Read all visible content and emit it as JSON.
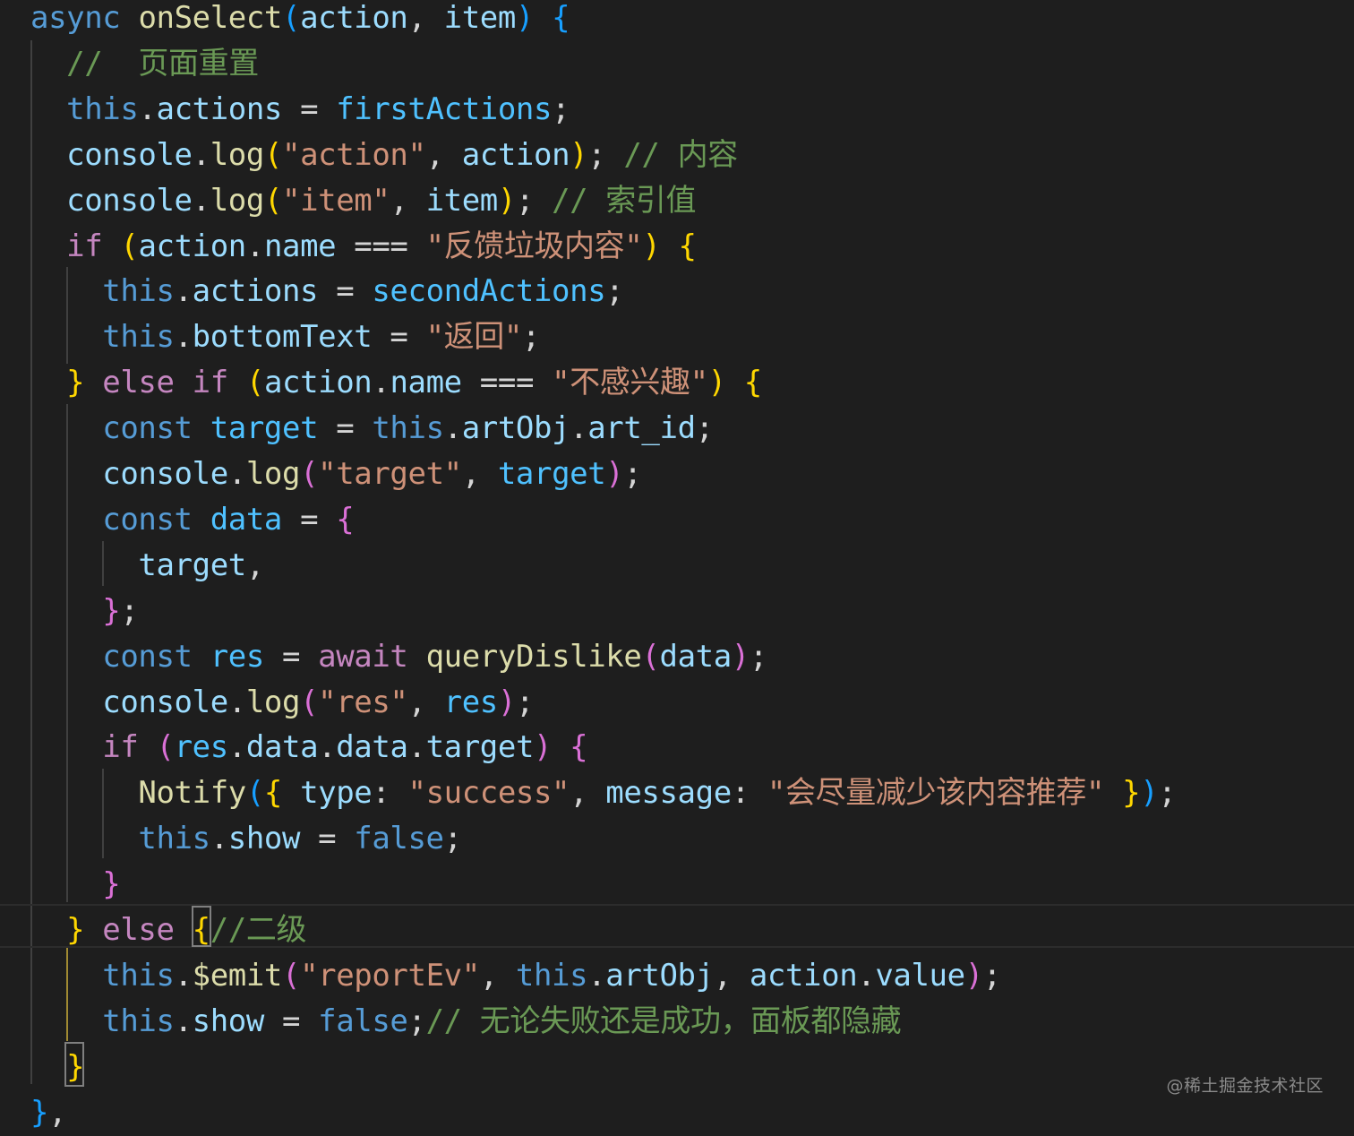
{
  "editor": {
    "language": "javascript",
    "theme_colors": {
      "background": "#1e1e1e",
      "keyword": "#569cd6",
      "control": "#c586c0",
      "function": "#dcdcaa",
      "variable": "#9cdcfe",
      "constant": "#4fc1ff",
      "string": "#ce9178",
      "comment": "#6a9955",
      "bracket_level1": "#ffd700",
      "bracket_level2": "#da70d6",
      "bracket_level3": "#179fff"
    },
    "lines": [
      [
        [
          "kw",
          "async"
        ],
        [
          "pu",
          " "
        ],
        [
          "fn",
          "onSelect"
        ],
        [
          "b3",
          "("
        ],
        [
          "var",
          "action"
        ],
        [
          "pu",
          ", "
        ],
        [
          "var",
          "item"
        ],
        [
          "b3",
          ")"
        ],
        [
          "pu",
          " "
        ],
        [
          "b3",
          "{"
        ]
      ],
      [
        [
          "pu",
          "  "
        ],
        [
          "cm",
          "//  页面重置"
        ]
      ],
      [
        [
          "pu",
          "  "
        ],
        [
          "kw",
          "this"
        ],
        [
          "pu",
          "."
        ],
        [
          "var",
          "actions"
        ],
        [
          "pu",
          " = "
        ],
        [
          "cst",
          "firstActions"
        ],
        [
          "pu",
          ";"
        ]
      ],
      [
        [
          "pu",
          "  "
        ],
        [
          "var",
          "console"
        ],
        [
          "pu",
          "."
        ],
        [
          "fn",
          "log"
        ],
        [
          "b1",
          "("
        ],
        [
          "str",
          "\"action\""
        ],
        [
          "pu",
          ", "
        ],
        [
          "var",
          "action"
        ],
        [
          "b1",
          ")"
        ],
        [
          "pu",
          "; "
        ],
        [
          "cm",
          "// 内容"
        ]
      ],
      [
        [
          "pu",
          "  "
        ],
        [
          "var",
          "console"
        ],
        [
          "pu",
          "."
        ],
        [
          "fn",
          "log"
        ],
        [
          "b1",
          "("
        ],
        [
          "str",
          "\"item\""
        ],
        [
          "pu",
          ", "
        ],
        [
          "var",
          "item"
        ],
        [
          "b1",
          ")"
        ],
        [
          "pu",
          "; "
        ],
        [
          "cm",
          "// 索引值"
        ]
      ],
      [
        [
          "pu",
          "  "
        ],
        [
          "ctl",
          "if"
        ],
        [
          "pu",
          " "
        ],
        [
          "b1",
          "("
        ],
        [
          "var",
          "action"
        ],
        [
          "pu",
          "."
        ],
        [
          "var",
          "name"
        ],
        [
          "pu",
          " === "
        ],
        [
          "str",
          "\"反馈垃圾内容\""
        ],
        [
          "b1",
          ")"
        ],
        [
          "pu",
          " "
        ],
        [
          "b1",
          "{"
        ]
      ],
      [
        [
          "pu",
          "    "
        ],
        [
          "kw",
          "this"
        ],
        [
          "pu",
          "."
        ],
        [
          "var",
          "actions"
        ],
        [
          "pu",
          " = "
        ],
        [
          "cst",
          "secondActions"
        ],
        [
          "pu",
          ";"
        ]
      ],
      [
        [
          "pu",
          "    "
        ],
        [
          "kw",
          "this"
        ],
        [
          "pu",
          "."
        ],
        [
          "var",
          "bottomText"
        ],
        [
          "pu",
          " = "
        ],
        [
          "str",
          "\"返回\""
        ],
        [
          "pu",
          ";"
        ]
      ],
      [
        [
          "pu",
          "  "
        ],
        [
          "b1",
          "}"
        ],
        [
          "pu",
          " "
        ],
        [
          "ctl",
          "else if"
        ],
        [
          "pu",
          " "
        ],
        [
          "b1",
          "("
        ],
        [
          "var",
          "action"
        ],
        [
          "pu",
          "."
        ],
        [
          "var",
          "name"
        ],
        [
          "pu",
          " === "
        ],
        [
          "str",
          "\"不感兴趣\""
        ],
        [
          "b1",
          ")"
        ],
        [
          "pu",
          " "
        ],
        [
          "b1",
          "{"
        ]
      ],
      [
        [
          "pu",
          "    "
        ],
        [
          "kw",
          "const"
        ],
        [
          "pu",
          " "
        ],
        [
          "cst",
          "target"
        ],
        [
          "pu",
          " = "
        ],
        [
          "kw",
          "this"
        ],
        [
          "pu",
          "."
        ],
        [
          "var",
          "artObj"
        ],
        [
          "pu",
          "."
        ],
        [
          "var",
          "art_id"
        ],
        [
          "pu",
          ";"
        ]
      ],
      [
        [
          "pu",
          "    "
        ],
        [
          "var",
          "console"
        ],
        [
          "pu",
          "."
        ],
        [
          "fn",
          "log"
        ],
        [
          "b2",
          "("
        ],
        [
          "str",
          "\"target\""
        ],
        [
          "pu",
          ", "
        ],
        [
          "cst",
          "target"
        ],
        [
          "b2",
          ")"
        ],
        [
          "pu",
          ";"
        ]
      ],
      [
        [
          "pu",
          "    "
        ],
        [
          "kw",
          "const"
        ],
        [
          "pu",
          " "
        ],
        [
          "cst",
          "data"
        ],
        [
          "pu",
          " = "
        ],
        [
          "b2",
          "{"
        ]
      ],
      [
        [
          "pu",
          "      "
        ],
        [
          "var",
          "target"
        ],
        [
          "pu",
          ","
        ]
      ],
      [
        [
          "pu",
          "    "
        ],
        [
          "b2",
          "}"
        ],
        [
          "pu",
          ";"
        ]
      ],
      [
        [
          "pu",
          "    "
        ],
        [
          "kw",
          "const"
        ],
        [
          "pu",
          " "
        ],
        [
          "cst",
          "res"
        ],
        [
          "pu",
          " = "
        ],
        [
          "ctl",
          "await"
        ],
        [
          "pu",
          " "
        ],
        [
          "fn",
          "queryDislike"
        ],
        [
          "b2",
          "("
        ],
        [
          "var",
          "data"
        ],
        [
          "b2",
          ")"
        ],
        [
          "pu",
          ";"
        ]
      ],
      [
        [
          "pu",
          "    "
        ],
        [
          "var",
          "console"
        ],
        [
          "pu",
          "."
        ],
        [
          "fn",
          "log"
        ],
        [
          "b2",
          "("
        ],
        [
          "str",
          "\"res\""
        ],
        [
          "pu",
          ", "
        ],
        [
          "cst",
          "res"
        ],
        [
          "b2",
          ")"
        ],
        [
          "pu",
          ";"
        ]
      ],
      [
        [
          "pu",
          "    "
        ],
        [
          "ctl",
          "if"
        ],
        [
          "pu",
          " "
        ],
        [
          "b2",
          "("
        ],
        [
          "cst",
          "res"
        ],
        [
          "pu",
          "."
        ],
        [
          "var",
          "data"
        ],
        [
          "pu",
          "."
        ],
        [
          "var",
          "data"
        ],
        [
          "pu",
          "."
        ],
        [
          "var",
          "target"
        ],
        [
          "b2",
          ")"
        ],
        [
          "pu",
          " "
        ],
        [
          "b2",
          "{"
        ]
      ],
      [
        [
          "pu",
          "      "
        ],
        [
          "fn",
          "Notify"
        ],
        [
          "b3",
          "("
        ],
        [
          "b1",
          "{"
        ],
        [
          "pu",
          " "
        ],
        [
          "var",
          "type"
        ],
        [
          "pu",
          ": "
        ],
        [
          "str",
          "\"success\""
        ],
        [
          "pu",
          ", "
        ],
        [
          "var",
          "message"
        ],
        [
          "pu",
          ": "
        ],
        [
          "str",
          "\"会尽量减少该内容推荐\""
        ],
        [
          "pu",
          " "
        ],
        [
          "b1",
          "}"
        ],
        [
          "b3",
          ")"
        ],
        [
          "pu",
          ";"
        ]
      ],
      [
        [
          "pu",
          "      "
        ],
        [
          "kw",
          "this"
        ],
        [
          "pu",
          "."
        ],
        [
          "var",
          "show"
        ],
        [
          "pu",
          " = "
        ],
        [
          "kw",
          "false"
        ],
        [
          "pu",
          ";"
        ]
      ],
      [
        [
          "pu",
          "    "
        ],
        [
          "b2",
          "}"
        ]
      ],
      [
        [
          "pu",
          "  "
        ],
        [
          "b1",
          "}"
        ],
        [
          "pu",
          " "
        ],
        [
          "ctl",
          "else"
        ],
        [
          "pu",
          " "
        ],
        [
          "b1",
          "{"
        ],
        [
          "cm",
          "//二级"
        ]
      ],
      [
        [
          "pu",
          "    "
        ],
        [
          "kw",
          "this"
        ],
        [
          "pu",
          "."
        ],
        [
          "fn",
          "$emit"
        ],
        [
          "b2",
          "("
        ],
        [
          "str",
          "\"reportEv\""
        ],
        [
          "pu",
          ", "
        ],
        [
          "kw",
          "this"
        ],
        [
          "pu",
          "."
        ],
        [
          "var",
          "artObj"
        ],
        [
          "pu",
          ", "
        ],
        [
          "var",
          "action"
        ],
        [
          "pu",
          "."
        ],
        [
          "var",
          "value"
        ],
        [
          "b2",
          ")"
        ],
        [
          "pu",
          ";"
        ]
      ],
      [
        [
          "pu",
          "    "
        ],
        [
          "kw",
          "this"
        ],
        [
          "pu",
          "."
        ],
        [
          "var",
          "show"
        ],
        [
          "pu",
          " = "
        ],
        [
          "kw",
          "false"
        ],
        [
          "pu",
          ";"
        ],
        [
          "cm",
          "// 无论失败还是成功，面板都隐藏"
        ]
      ],
      [
        [
          "pu",
          "  "
        ],
        [
          "b1",
          "}"
        ]
      ],
      [
        [
          "b3",
          "}"
        ],
        [
          "pu",
          ","
        ]
      ]
    ]
  },
  "watermark": {
    "text": "@稀土掘金技术社区"
  }
}
